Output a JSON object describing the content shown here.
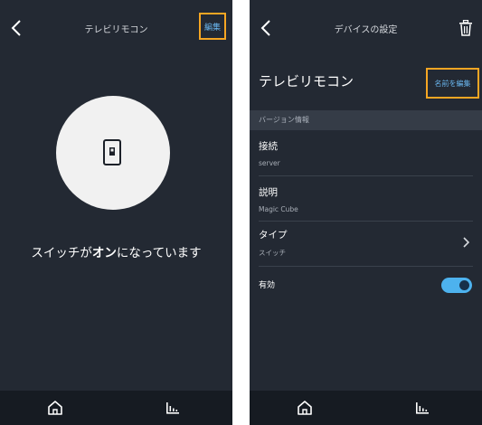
{
  "left": {
    "title": "テレビリモコン",
    "edit_label": "編集",
    "status": {
      "prefix": "スイッチが",
      "state": "オン",
      "suffix": "になっています"
    }
  },
  "right": {
    "title": "デバイスの設定",
    "device_name": "テレビリモコン",
    "rename_label": "名前を編集",
    "section_label": "バージョン情報",
    "rows": [
      {
        "label": "接続",
        "value": "server"
      },
      {
        "label": "説明",
        "value": "Magic Cube"
      },
      {
        "label": "タイプ",
        "value": "スイッチ"
      }
    ],
    "enabled_label": "有効",
    "enabled": true
  },
  "nav": {
    "items": [
      "home-icon",
      "stats-icon"
    ]
  },
  "colors": {
    "background": "#232933",
    "accent": "#4db2ee",
    "highlight": "#f6a623",
    "link": "#6ab7f0"
  }
}
